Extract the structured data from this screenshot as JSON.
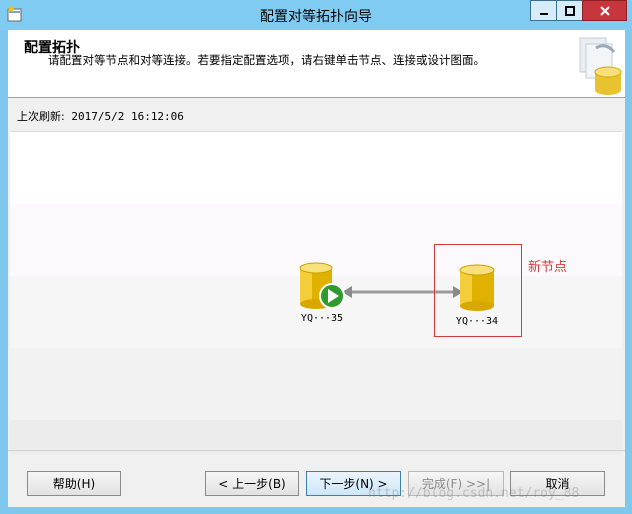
{
  "window": {
    "title": "配置对等拓扑向导",
    "minimize": "minimize",
    "maximize": "maximize",
    "close": "close"
  },
  "header": {
    "title": "配置拓扑",
    "description": "请配置对等节点和对等连接。若要指定配置选项，请右键单击节点、连接或设计图面。"
  },
  "refresh": {
    "label": "上次刷新:",
    "value": "2017/5/2 16:12:06"
  },
  "topology": {
    "nodes": [
      {
        "label": "YQ···35",
        "status": "play-icon"
      },
      {
        "label": "YQ···34"
      }
    ],
    "connection": "bidirectional-arrow",
    "annotation": "新节点",
    "annotation_color": "#d83a3a",
    "node_color": "#e8b400"
  },
  "buttons": {
    "help": "帮助(H)",
    "back": "< 上一步(B)",
    "next": "下一步(N) >",
    "finish": "完成(F) >>|",
    "cancel": "取消"
  },
  "watermark": "http://blog.csdn.net/roy_88"
}
